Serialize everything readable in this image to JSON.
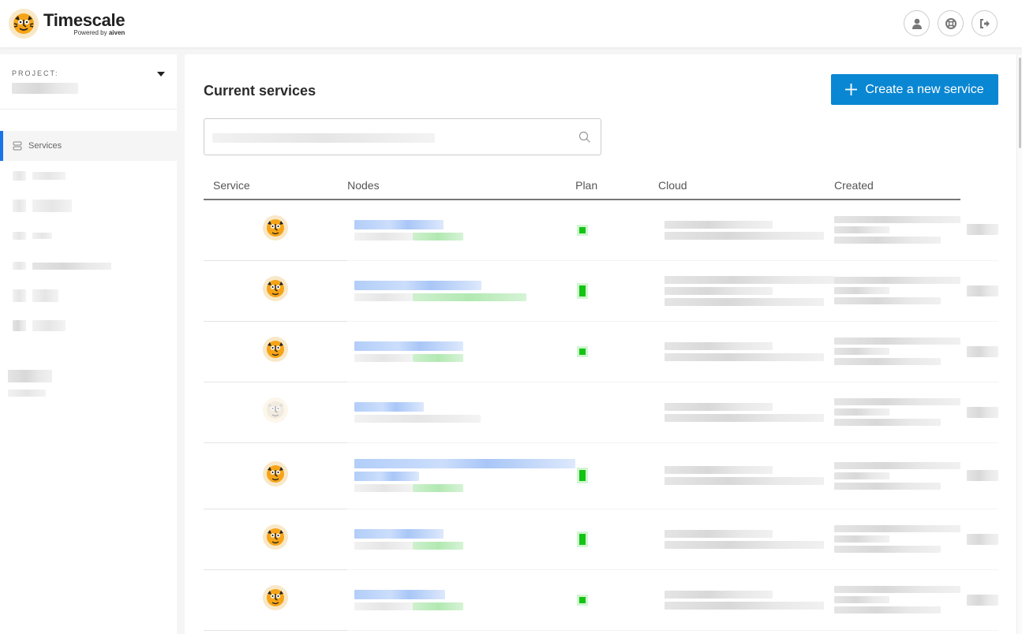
{
  "app": {
    "title": "Timescale",
    "subtitle_prefix": "Powered by ",
    "subtitle_brand": "aiven"
  },
  "topbar": {
    "icons": [
      "user-icon",
      "support-lifebuoy-icon",
      "logout-icon"
    ]
  },
  "sidebar": {
    "project_label": "PROJECT:",
    "project_value": "[redacted]",
    "items": [
      {
        "label": "Services",
        "icon": "services-icon",
        "active": true
      },
      {
        "label": "[redacted]",
        "active": false
      },
      {
        "label": "[redacted]",
        "active": false
      },
      {
        "label": "[redacted]",
        "active": false
      },
      {
        "label": "[redacted]",
        "active": false
      },
      {
        "label": "[redacted]",
        "active": false
      },
      {
        "label": "[redacted]",
        "active": false
      }
    ],
    "user": {
      "name": "[redacted]",
      "detail": "[redacted]"
    }
  },
  "main": {
    "title": "Current services",
    "create_button": "Create a new service",
    "search": {
      "value": "",
      "placeholder": "[redacted]"
    },
    "table": {
      "columns": [
        "Service",
        "Nodes",
        "Plan",
        "Cloud",
        "Created"
      ],
      "rows": [
        {
          "name": "[redacted]",
          "status": "running",
          "nodes": 1,
          "plan": "[redacted]",
          "cloud": "[redacted]",
          "created": "[redacted]"
        },
        {
          "name": "[redacted]",
          "status": "running",
          "nodes": 2,
          "plan": "[redacted]",
          "cloud": "[redacted]",
          "created": "[redacted]"
        },
        {
          "name": "[redacted]",
          "status": "running",
          "nodes": 1,
          "plan": "[redacted]",
          "cloud": "[redacted]",
          "created": "[redacted]"
        },
        {
          "name": "[redacted]",
          "status": "powered-off",
          "nodes": 0,
          "plan": "[redacted]",
          "cloud": "[redacted]",
          "created": "[redacted]"
        },
        {
          "name": "[redacted]",
          "status": "running",
          "nodes": 2,
          "plan": "[redacted]",
          "cloud": "[redacted]",
          "created": "[redacted]"
        },
        {
          "name": "[redacted]",
          "status": "running",
          "nodes": 2,
          "plan": "[redacted]",
          "cloud": "[redacted]",
          "created": "[redacted]"
        },
        {
          "name": "[redacted]",
          "status": "running",
          "nodes": 1,
          "plan": "[redacted]",
          "cloud": "[redacted]",
          "created": "[redacted]"
        }
      ]
    }
  },
  "colors": {
    "accent": "#0a87d3",
    "nav_active": "#1a73e8",
    "node_running": "#14c414"
  }
}
